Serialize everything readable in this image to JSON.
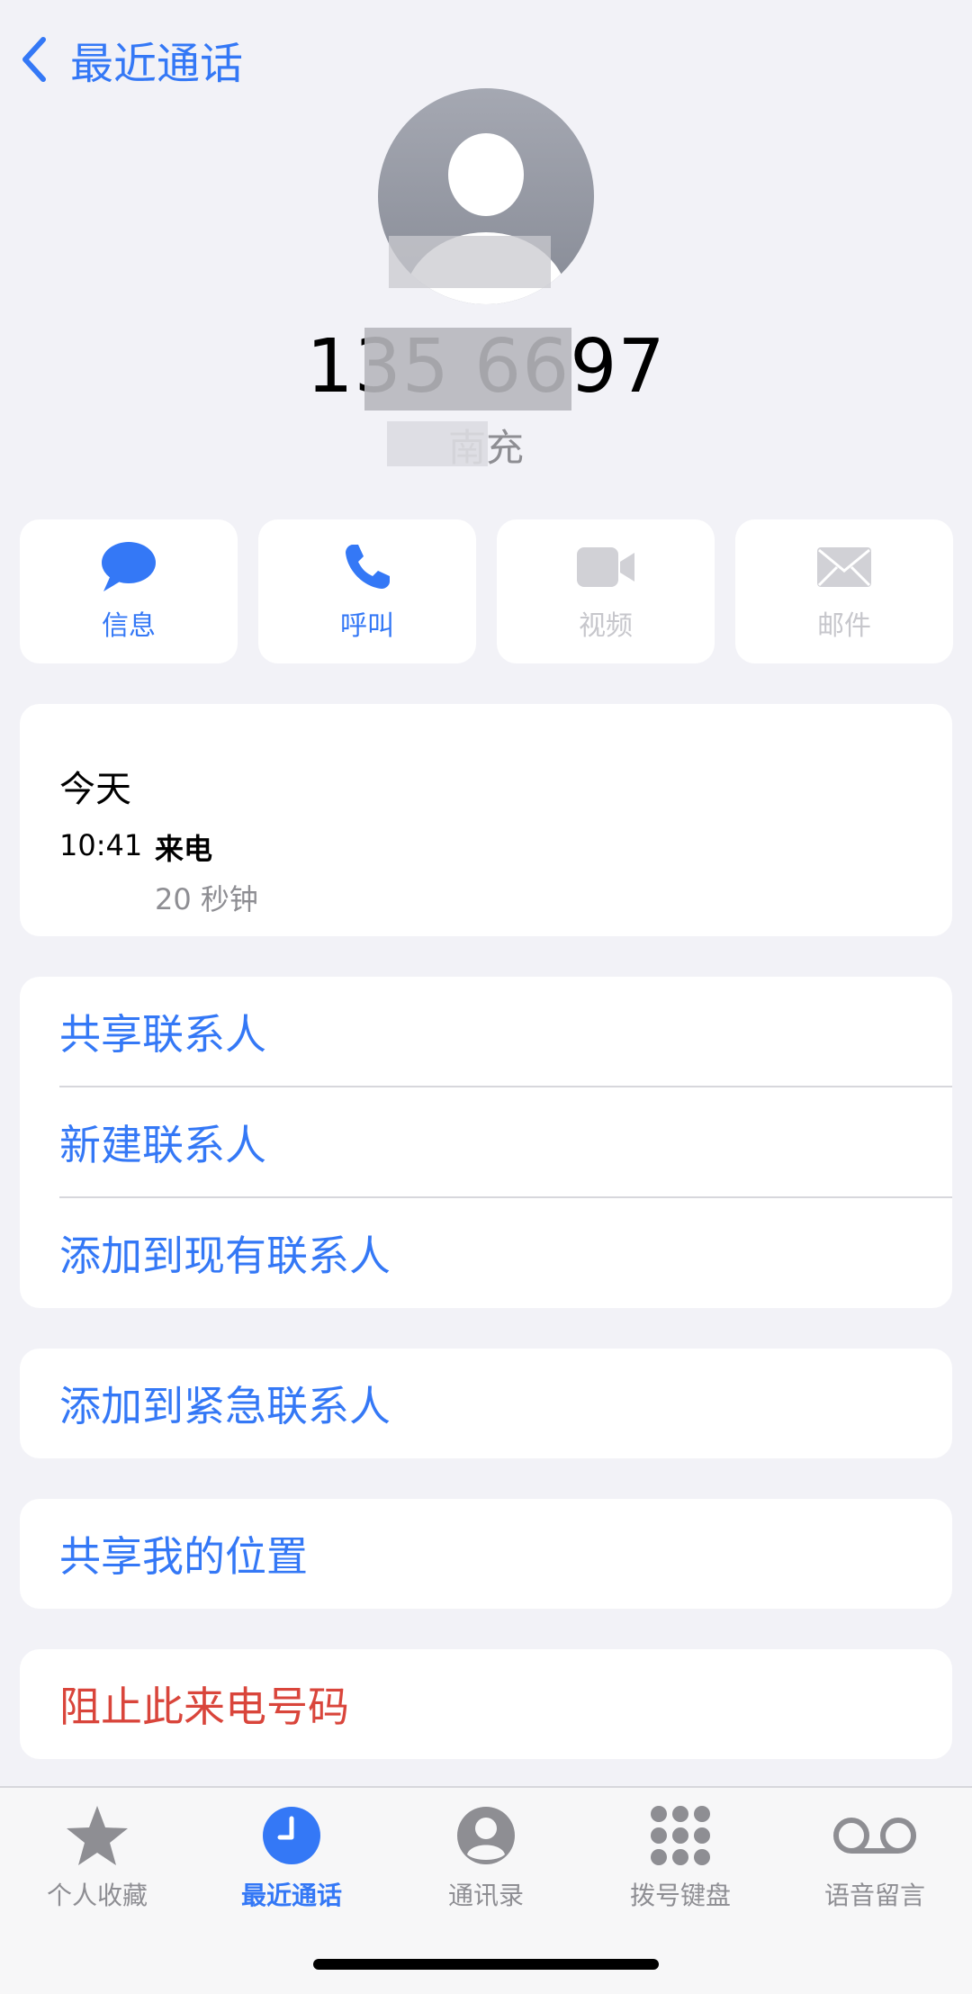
{
  "nav": {
    "back_label": "最近通话"
  },
  "contact": {
    "phone_number": "135 6697",
    "location": "南充"
  },
  "actions": [
    {
      "label": "信息",
      "icon": "message-bubble-icon",
      "enabled": true
    },
    {
      "label": "呼叫",
      "icon": "phone-icon",
      "enabled": true
    },
    {
      "label": "视频",
      "icon": "video-camera-icon",
      "enabled": false
    },
    {
      "label": "邮件",
      "icon": "envelope-icon",
      "enabled": false
    }
  ],
  "call_log": {
    "day": "今天",
    "time": "10:41",
    "type": "来电",
    "duration": "20 秒钟"
  },
  "options_group1": [
    "共享联系人",
    "新建联系人",
    "添加到现有联系人"
  ],
  "options_group2": [
    "添加到紧急联系人"
  ],
  "options_group3": [
    "共享我的位置"
  ],
  "options_group4": [
    "阻止此来电号码"
  ],
  "tabbar": {
    "tabs": [
      {
        "label": "个人收藏",
        "icon": "star-icon"
      },
      {
        "label": "最近通话",
        "icon": "clock-icon",
        "active": true
      },
      {
        "label": "通讯录",
        "icon": "person-circle-icon"
      },
      {
        "label": "拨号键盘",
        "icon": "keypad-icon"
      },
      {
        "label": "语音留言",
        "icon": "voicemail-icon"
      }
    ]
  },
  "colors": {
    "accent": "#3478f6",
    "destructive": "#d9453b",
    "background": "#f2f2f7",
    "secondary_text": "#8e8e93"
  }
}
